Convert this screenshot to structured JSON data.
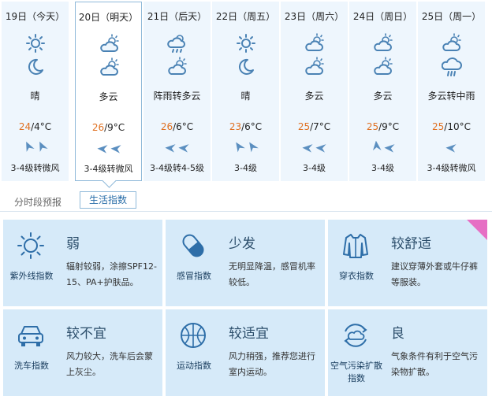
{
  "forecast": {
    "days": [
      {
        "date": "19日（今天）",
        "icon1": "sun-icon",
        "icon2": "moon-icon",
        "condition": "晴",
        "high": "24",
        "low": "/4°C",
        "wind": "3-4级转微风"
      },
      {
        "date": "20日（明天）",
        "icon1": "partly-cloudy-icon",
        "icon2": "partly-cloudy-icon",
        "condition": "多云",
        "high": "26",
        "low": "/9°C",
        "wind": "3-4级转微风"
      },
      {
        "date": "21日（后天）",
        "icon1": "shower-icon",
        "icon2": "partly-cloudy-icon",
        "condition": "阵雨转多云",
        "high": "26",
        "low": "/6°C",
        "wind": "3-4级转4-5级"
      },
      {
        "date": "22日（周五）",
        "icon1": "sun-icon",
        "icon2": "moon-icon",
        "condition": "晴",
        "high": "23",
        "low": "/6°C",
        "wind": "3-4级"
      },
      {
        "date": "23日（周六）",
        "icon1": "partly-cloudy-icon",
        "icon2": "partly-cloudy-icon",
        "condition": "多云",
        "high": "25",
        "low": "/7°C",
        "wind": "3-4级"
      },
      {
        "date": "24日（周日）",
        "icon1": "partly-cloudy-icon",
        "icon2": "partly-cloudy-icon",
        "condition": "多云",
        "high": "25",
        "low": "/9°C",
        "wind": "3-4级"
      },
      {
        "date": "25日（周一）",
        "icon1": "partly-cloudy-icon",
        "icon2": "rain-icon",
        "condition": "多云转中雨",
        "high": "25",
        "low": "/10°C",
        "wind": "3-4级转微风"
      }
    ],
    "selected_index": 1
  },
  "tabs": {
    "hourly_label": "分时段预报",
    "life_label": "生活指数"
  },
  "life_index": {
    "uv": {
      "name": "紫外线指数",
      "level": "弱",
      "desc": "辐射较弱，涂擦SPF12-15、PA+护肤品。",
      "icon": "sun-outline-icon"
    },
    "cold": {
      "name": "感冒指数",
      "level": "少发",
      "desc": "无明显降温，感冒机率较低。",
      "icon": "pill-icon"
    },
    "dressing": {
      "name": "穿衣指数",
      "level": "较舒适",
      "desc": "建议穿薄外套或牛仔裤等服装。",
      "icon": "coat-icon"
    },
    "carwash": {
      "name": "洗车指数",
      "level": "较不宜",
      "desc": "风力较大，洗车后会蒙上灰尘。",
      "icon": "car-icon"
    },
    "sport": {
      "name": "运动指数",
      "level": "较适宜",
      "desc": "风力稍强，推荐您进行室内运动。",
      "icon": "ball-icon"
    },
    "air": {
      "name1": "空气污染扩散",
      "name2": "指数",
      "level": "良",
      "desc": "气象条件有利于空气污染物扩散。",
      "icon": "air-cycle-icon"
    }
  },
  "colors": {
    "accent": "#2a6ea8",
    "high_temp": "#e07020",
    "card_bg": "#d6eaf9",
    "day_bg": "#eef6fd",
    "icon": "#4a82b4"
  }
}
